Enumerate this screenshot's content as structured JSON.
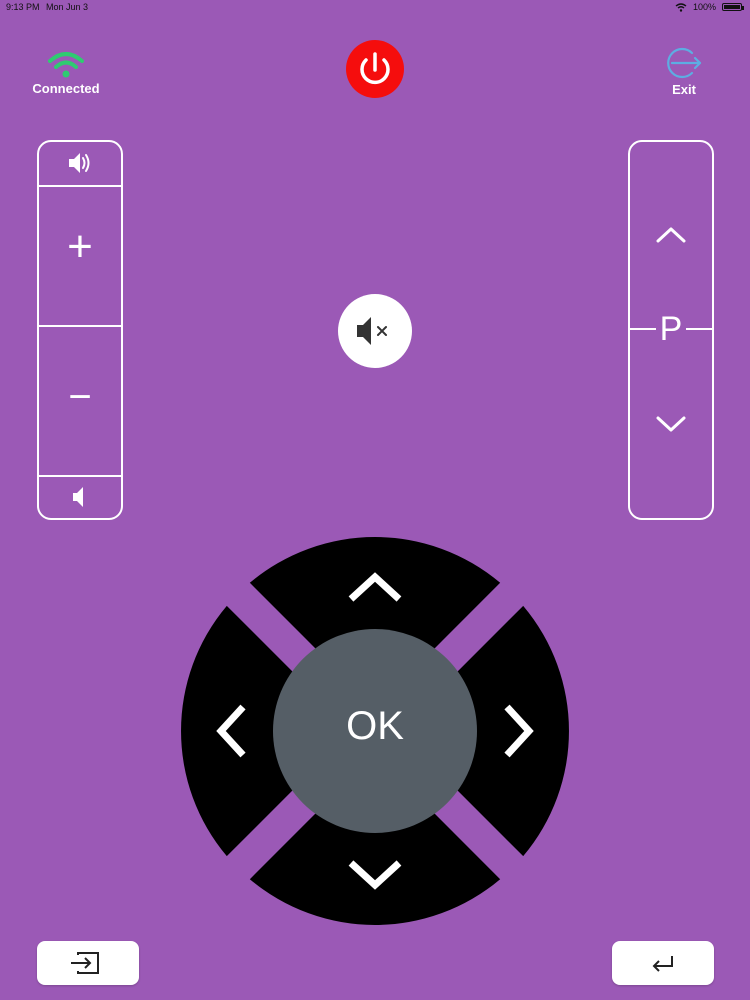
{
  "status_bar": {
    "time": "9:13 PM",
    "date": "Mon Jun 3",
    "battery": "100%"
  },
  "header": {
    "connection_label": "Connected",
    "exit_label": "Exit"
  },
  "icons": {
    "wifi": "wifi-icon",
    "power": "power-icon",
    "exit": "exit-icon",
    "volume_up": "speaker-loud-icon",
    "volume_down": "speaker-quiet-icon",
    "mute": "mute-icon",
    "input": "input-source-icon",
    "back": "return-icon"
  },
  "volume": {
    "plus_label": "+",
    "minus_label": "−"
  },
  "channel": {
    "label": "P"
  },
  "dpad": {
    "ok_label": "OK"
  },
  "colors": {
    "background": "#9b59b6",
    "power": "#f50d0d",
    "connected": "#2ecc71",
    "exit": "#5dade2",
    "dpad": "#000000",
    "ok": "#555e66"
  }
}
